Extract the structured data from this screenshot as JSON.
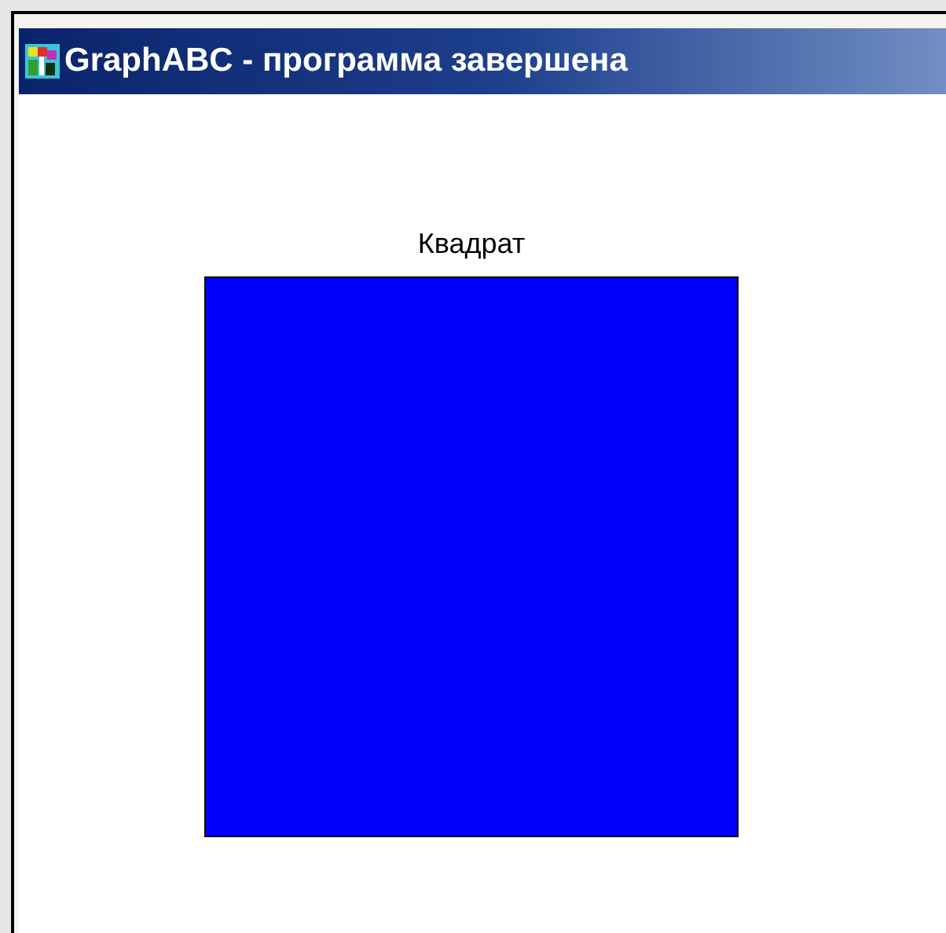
{
  "window": {
    "title": "GraphABC - программа завершена"
  },
  "canvas": {
    "label": "Квадрат",
    "shape": {
      "kind": "square",
      "color": "#0000ff"
    }
  }
}
